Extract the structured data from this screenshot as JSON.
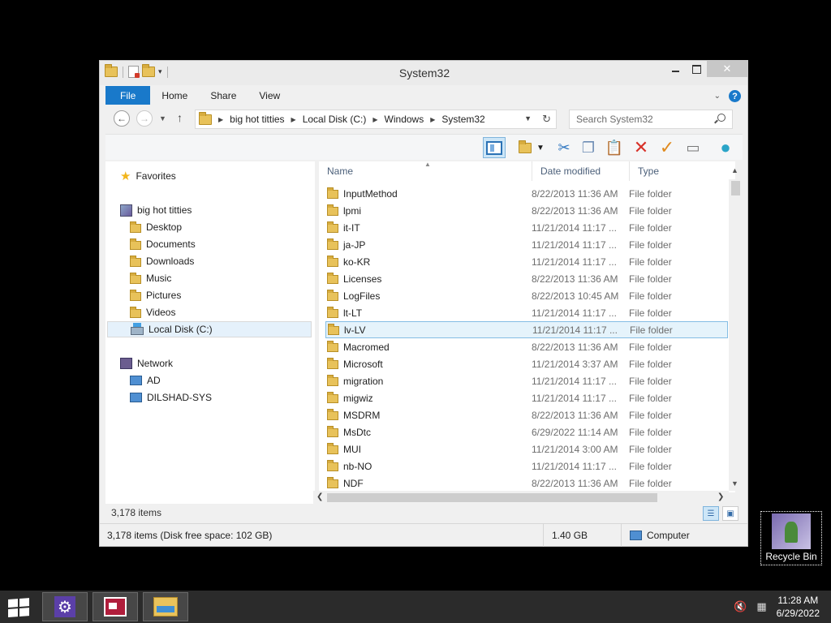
{
  "window": {
    "title": "System32",
    "close_glyph": "✕"
  },
  "ribbon": {
    "tabs": [
      "File",
      "Home",
      "Share",
      "View"
    ],
    "help_glyph": "?"
  },
  "address": {
    "segments": [
      "big hot titties",
      "Local Disk (C:)",
      "Windows",
      "System32"
    ],
    "search_placeholder": "Search System32"
  },
  "nav": {
    "favorites": "Favorites",
    "user": "big hot titties",
    "user_items": [
      "Desktop",
      "Documents",
      "Downloads",
      "Music",
      "Pictures",
      "Videos",
      "Local Disk (C:)"
    ],
    "network": "Network",
    "network_items": [
      "AD",
      "DILSHAD-SYS"
    ]
  },
  "list": {
    "columns": [
      "Name",
      "Date modified",
      "Type"
    ],
    "rows": [
      {
        "name": "InputMethod",
        "date": "8/22/2013 11:36 AM",
        "type": "File folder"
      },
      {
        "name": "lpmi",
        "date": "8/22/2013 11:36 AM",
        "type": "File folder"
      },
      {
        "name": "it-IT",
        "date": "11/21/2014 11:17 ...",
        "type": "File folder"
      },
      {
        "name": "ja-JP",
        "date": "11/21/2014 11:17 ...",
        "type": "File folder"
      },
      {
        "name": "ko-KR",
        "date": "11/21/2014 11:17 ...",
        "type": "File folder"
      },
      {
        "name": "Licenses",
        "date": "8/22/2013 11:36 AM",
        "type": "File folder"
      },
      {
        "name": "LogFiles",
        "date": "8/22/2013 10:45 AM",
        "type": "File folder"
      },
      {
        "name": "lt-LT",
        "date": "11/21/2014 11:17 ...",
        "type": "File folder"
      },
      {
        "name": "lv-LV",
        "date": "11/21/2014 11:17 ...",
        "type": "File folder"
      },
      {
        "name": "Macromed",
        "date": "8/22/2013 11:36 AM",
        "type": "File folder"
      },
      {
        "name": "Microsoft",
        "date": "11/21/2014 3:37 AM",
        "type": "File folder"
      },
      {
        "name": "migration",
        "date": "11/21/2014 11:17 ...",
        "type": "File folder"
      },
      {
        "name": "migwiz",
        "date": "11/21/2014 11:17 ...",
        "type": "File folder"
      },
      {
        "name": "MSDRM",
        "date": "8/22/2013 11:36 AM",
        "type": "File folder"
      },
      {
        "name": "MsDtc",
        "date": "6/29/2022 11:14 AM",
        "type": "File folder"
      },
      {
        "name": "MUI",
        "date": "11/21/2014 3:00 AM",
        "type": "File folder"
      },
      {
        "name": "nb-NO",
        "date": "11/21/2014 11:17 ...",
        "type": "File folder"
      },
      {
        "name": "NDF",
        "date": "8/22/2013 11:36 AM",
        "type": "File folder"
      }
    ],
    "selected_index": 8
  },
  "status": {
    "items_count": "3,178 items",
    "bar_left": "3,178 items (Disk free space: 102 GB)",
    "bar_size": "1.40 GB",
    "bar_location": "Computer"
  },
  "desktop": {
    "recycle_bin": "Recycle Bin"
  },
  "taskbar": {
    "time": "11:28 AM",
    "date": "6/29/2022"
  }
}
